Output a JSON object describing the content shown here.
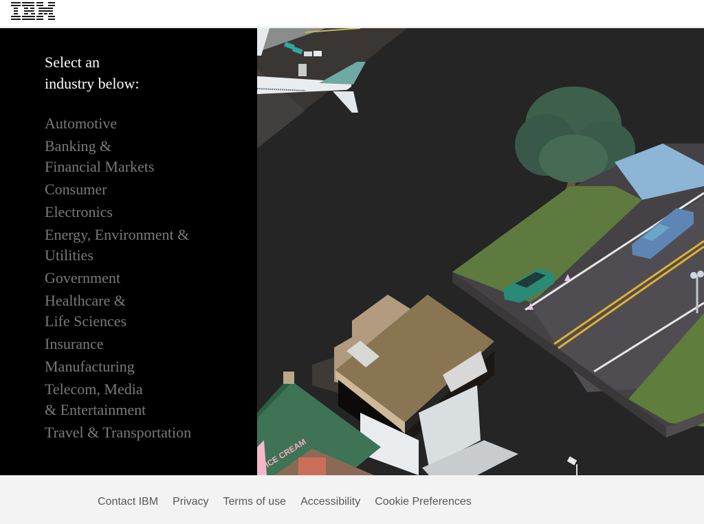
{
  "header": {
    "logo_text": "IBM"
  },
  "panel": {
    "prompt_line1": "Select an",
    "prompt_line2": "industry below:",
    "industries": [
      {
        "line1": "Automotive",
        "line2": ""
      },
      {
        "line1": "Banking &",
        "line2": "Financial Markets"
      },
      {
        "line1": "Consumer",
        "line2": ""
      },
      {
        "line1": "Electronics",
        "line2": ""
      },
      {
        "line1": "Energy, Environment &",
        "line2": "Utilities"
      },
      {
        "line1": "Government",
        "line2": ""
      },
      {
        "line1": "Healthcare &",
        "line2": "Life Sciences"
      },
      {
        "line1": "Insurance",
        "line2": ""
      },
      {
        "line1": "Manufacturing",
        "line2": ""
      },
      {
        "line1": "Telecom, Media",
        "line2": "& Entertainment"
      },
      {
        "line1": "Travel & Transportation",
        "line2": ""
      }
    ]
  },
  "scene": {
    "description": "Isometric city illustration: airport with airplane, road with cars, tree, ice cream shop, modern building",
    "shop_sign": "ICE CREAM"
  },
  "footer": {
    "links": [
      "Contact IBM",
      "Privacy",
      "Terms of use",
      "Accessibility",
      "Cookie Preferences"
    ]
  },
  "colors": {
    "panel_bg": "#000000",
    "prompt_text": "#ffffff",
    "industry_text": "#7a7a7a",
    "scene_bg": "#252525",
    "footer_bg": "#f3f3f3",
    "footer_text": "#565656"
  }
}
